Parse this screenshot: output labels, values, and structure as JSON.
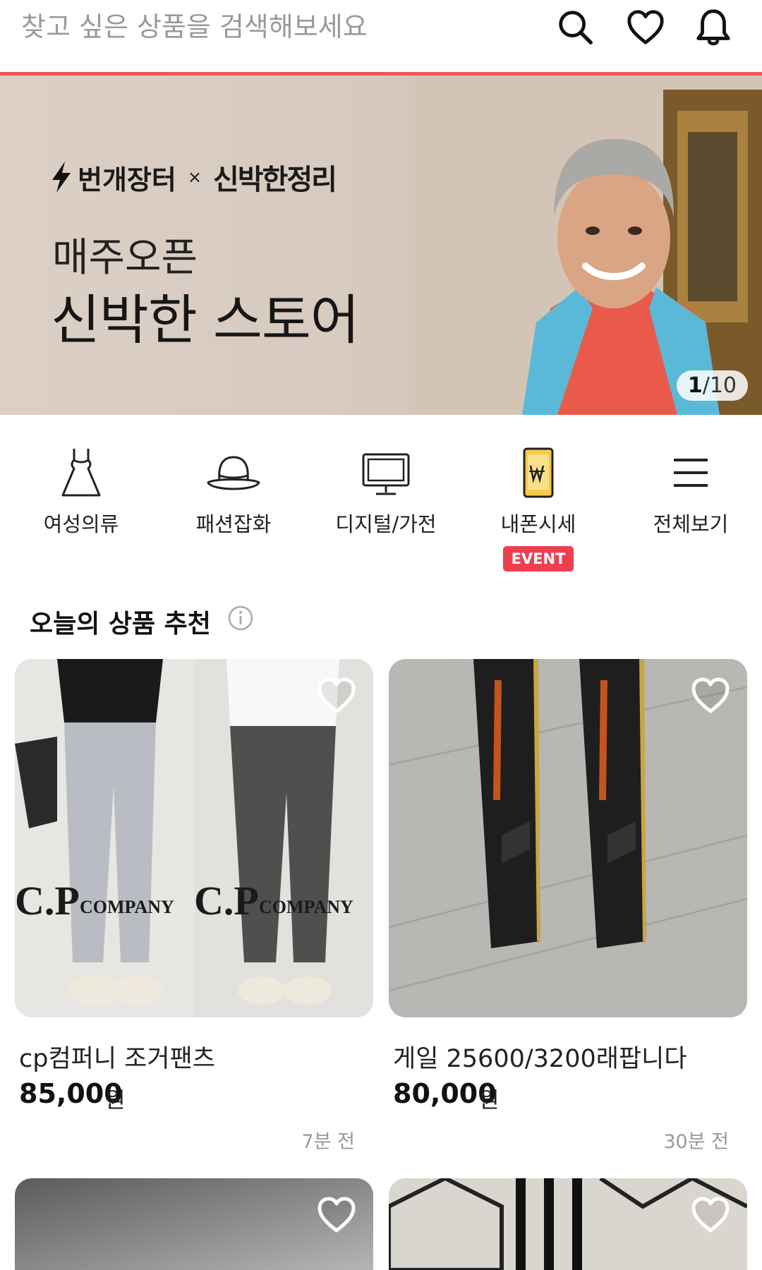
{
  "search": {
    "placeholder": "찾고 싶은 상품을 검색해보세요"
  },
  "header_icons": [
    "search-icon",
    "heart-icon",
    "bell-icon"
  ],
  "banner": {
    "brand_left": "번개장터",
    "brand_x": "×",
    "brand_right": "신박한정리",
    "subtitle": "매주오픈",
    "title": "신박한 스토어",
    "counter_current": "1",
    "counter_total": "/10"
  },
  "categories": [
    {
      "label": "여성의류",
      "icon": "dress-icon"
    },
    {
      "label": "패션잡화",
      "icon": "hat-icon"
    },
    {
      "label": "디지털/가전",
      "icon": "monitor-icon"
    },
    {
      "label": "내폰시세",
      "icon": "phone-won-icon",
      "badge": "EVENT"
    },
    {
      "label": "전체보기",
      "icon": "menu-icon"
    }
  ],
  "section": {
    "title": "오늘의 상품 추천"
  },
  "products": [
    {
      "name": "cp컴퍼니 조거팬츠",
      "price": "85,000",
      "currency": "원",
      "time": "7분 전"
    },
    {
      "name": "게일 25600/3200래팝니다",
      "price": "80,000",
      "currency": "원",
      "time": "30분 전"
    }
  ],
  "colors": {
    "accent": "#ef5858",
    "event": "#ee3f4f"
  }
}
